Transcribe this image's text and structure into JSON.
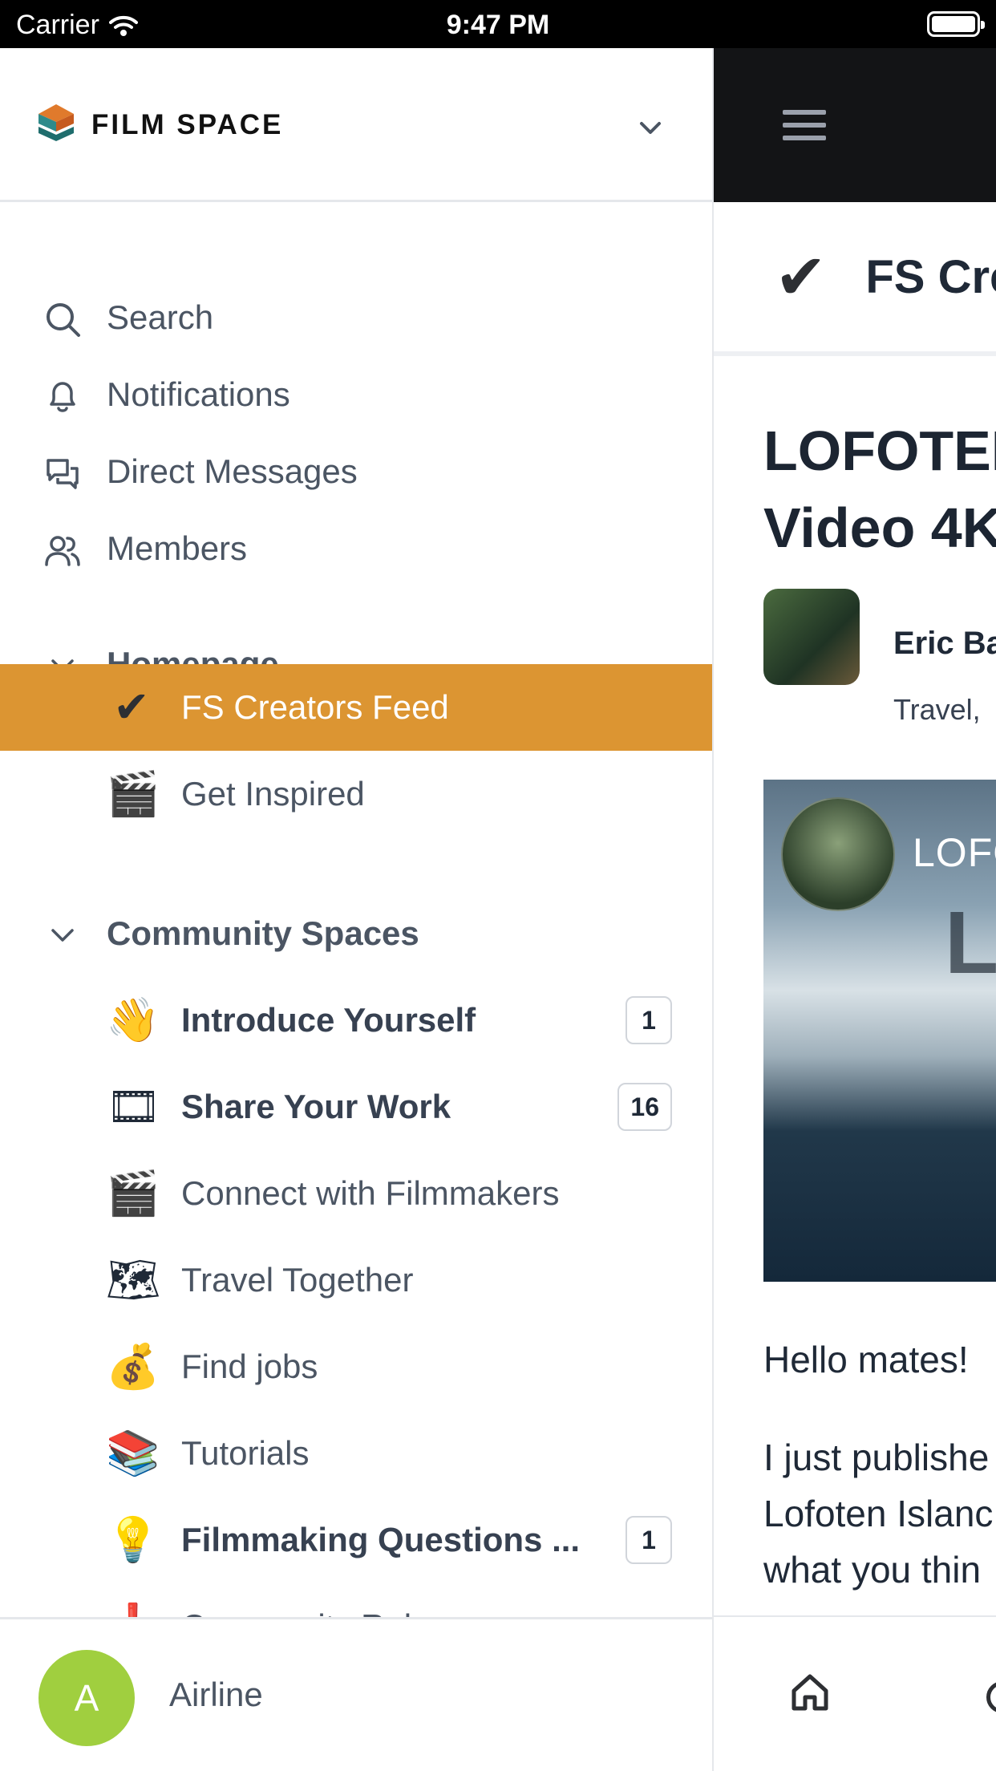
{
  "status_bar": {
    "carrier": "Carrier",
    "time": "9:47 PM"
  },
  "brand": {
    "name": "FILM SPACE"
  },
  "nav": [
    {
      "label": "Search",
      "icon": "search-icon"
    },
    {
      "label": "Notifications",
      "icon": "bell-icon"
    },
    {
      "label": "Direct Messages",
      "icon": "chat-bubbles-icon"
    },
    {
      "label": "Members",
      "icon": "members-icon"
    }
  ],
  "sections": {
    "homepage": {
      "label": "Homepage",
      "items": [
        {
          "emoji": "✔",
          "label": "FS Creators Feed",
          "active": true
        },
        {
          "emoji": "🎬",
          "label": "Get Inspired"
        }
      ]
    },
    "community": {
      "label": "Community Spaces",
      "items": [
        {
          "emoji": "👋",
          "label": "Introduce Yourself",
          "count": "1"
        },
        {
          "emoji": "🎞",
          "label": "Share Your Work",
          "count": "16"
        },
        {
          "emoji": "🎬",
          "label": "Connect with Filmmakers"
        },
        {
          "emoji": "🗺",
          "label": "Travel Together"
        },
        {
          "emoji": "💰",
          "label": "Find jobs"
        },
        {
          "emoji": "📚",
          "label": "Tutorials"
        },
        {
          "emoji": "💡",
          "label": "Filmmaking Questions ...",
          "count": "1"
        },
        {
          "emoji": "❗",
          "label": "Community Rules"
        }
      ]
    }
  },
  "footer": {
    "avatar_initial": "A",
    "name": "Airline"
  },
  "main": {
    "space_title": "FS Cre",
    "post_title_lines": [
      "LOFOTEN",
      "Video 4K"
    ],
    "author_name": "Eric Ba",
    "author_meta": "Travel,",
    "hero_text": "LOFO",
    "hero_letter": "L",
    "greeting": "Hello mates!",
    "body_lines": [
      "I just publishe",
      "Lofoten Islanc",
      "what you thin"
    ]
  },
  "colors": {
    "active_bg": "#dc9532",
    "avatar_bg": "#a0cf3f",
    "header_bg": "#131416"
  }
}
